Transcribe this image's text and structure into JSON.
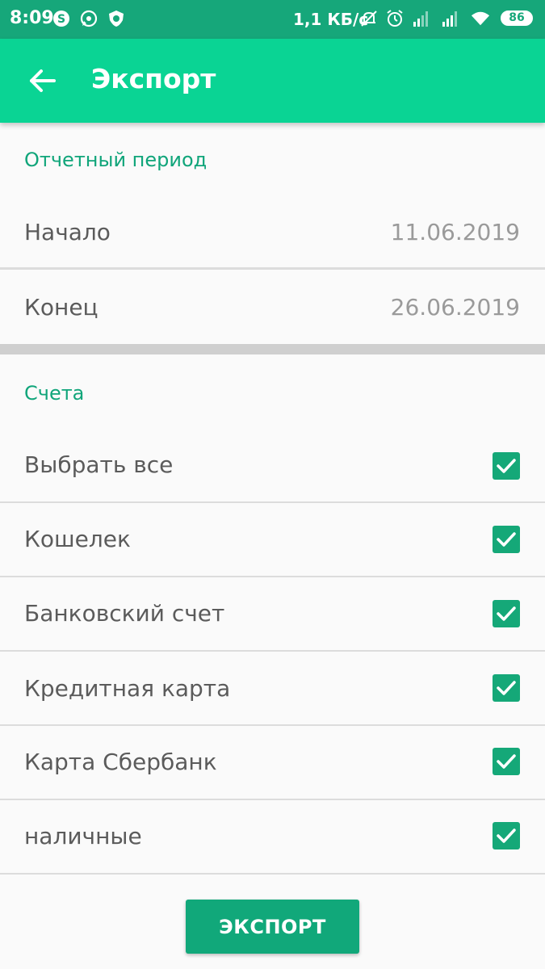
{
  "status_bar": {
    "time": "8:09",
    "speed": "1,1 КБ/с",
    "battery": "86",
    "icons": [
      "skype-icon",
      "whatsapp-icon",
      "shield-icon",
      "mute-icon",
      "alarm-icon",
      "signal-icon",
      "signal-icon",
      "wifi-icon"
    ]
  },
  "app_bar": {
    "title": "Экспорт",
    "back_icon": "arrow-left-icon"
  },
  "period": {
    "header": "Отчетный период",
    "start_label": "Начало",
    "start_value": "11.06.2019",
    "end_label": "Конец",
    "end_value": "26.06.2019"
  },
  "accounts": {
    "header": "Счета",
    "items": [
      {
        "label": "Выбрать все",
        "checked": true
      },
      {
        "label": "Кошелек",
        "checked": true
      },
      {
        "label": "Банковский счет",
        "checked": true
      },
      {
        "label": "Кредитная карта",
        "checked": true
      },
      {
        "label": "Карта Сбербанк",
        "checked": true
      },
      {
        "label": "наличные",
        "checked": true
      }
    ]
  },
  "export_button": "ЭКСПОРТ",
  "colors": {
    "status_bar": "#16a77a",
    "app_bar": "#0ad494",
    "accent": "#10a57a",
    "checkbox": "#15a878"
  }
}
